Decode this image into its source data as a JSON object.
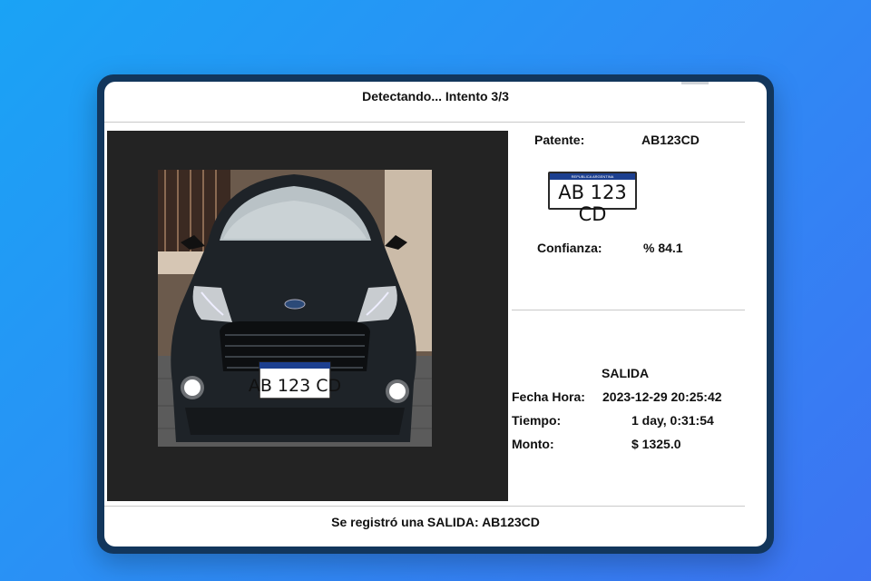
{
  "header": {
    "status": "Detectando... Intento 3/3"
  },
  "plate_image": {
    "country": "REPUBLICA ARGENTINA",
    "text": "AB 123 CD"
  },
  "detection": {
    "patente_label": "Patente:",
    "patente_value": "AB123CD",
    "confianza_label": "Confianza:",
    "confianza_value": "% 84.1"
  },
  "record": {
    "type": "SALIDA",
    "fecha_hora_label": "Fecha Hora:",
    "fecha_hora_value": "2023-12-29 20:25:42",
    "tiempo_label": "Tiempo:",
    "tiempo_value": "1 day, 0:31:54",
    "monto_label": "Monto:",
    "monto_value": "$ 1325.0"
  },
  "footer": {
    "message": "Se registró una SALIDA: AB123CD"
  }
}
